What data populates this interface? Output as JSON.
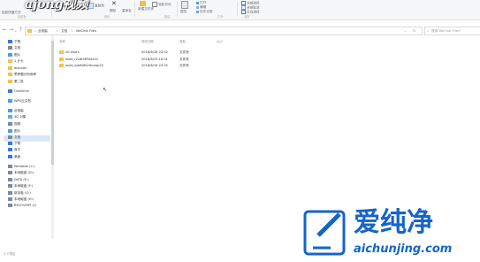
{
  "overlay_title": "ajong视频",
  "ribbon": {
    "groups": [
      {
        "label": "剪贴板"
      },
      {
        "label": "组织"
      },
      {
        "label": "新建"
      },
      {
        "label": "打开"
      },
      {
        "label": "选择"
      }
    ],
    "items": {
      "paste_shortcut": "粘贴快捷方式",
      "move_to": "移动到",
      "copy_to": "复制到",
      "delete": "删除",
      "rename": "重命名",
      "new_folder": "新建文件夹",
      "easy_access": "轻松访问",
      "properties": "属性",
      "open": "打开",
      "edit": "编辑",
      "history": "历史记录",
      "select_all": "全部选择",
      "select_none": "全部取消",
      "invert": "反向选择"
    }
  },
  "addressbar": {
    "breadcrumbs": [
      "此电脑",
      "文档",
      "WeChat Files"
    ],
    "search_placeholder": "搜索\"WeChat Files\""
  },
  "nav": [
    {
      "label": "下载",
      "icon": "download-icon",
      "color": "#3b78d8"
    },
    {
      "label": "文档",
      "icon": "document-icon",
      "color": "#7a8aa0"
    },
    {
      "label": "图片",
      "icon": "picture-icon",
      "color": "#4aa0d8"
    },
    {
      "label": "1 计头",
      "icon": "folder-icon",
      "color": "#f1c24b"
    },
    {
      "label": "dianvan",
      "icon": "folder-icon",
      "color": "#f1c24b"
    },
    {
      "label": "思考题分析和考",
      "icon": "folder-icon",
      "color": "#f1c24b"
    },
    {
      "label": "第二批",
      "icon": "folder-icon",
      "color": "#f1c24b"
    },
    {
      "label": "OneDrive",
      "icon": "cloud-icon",
      "color": "#3b78d8"
    },
    {
      "label": "WPS云文档",
      "icon": "cloud-icon",
      "color": "#4aa0d8"
    },
    {
      "label": "此电脑",
      "icon": "computer-icon",
      "color": "#4aa0d8"
    },
    {
      "label": "3D 对象",
      "icon": "cube-icon",
      "color": "#6aaae0"
    },
    {
      "label": "视频",
      "icon": "video-icon",
      "color": "#7a8aa0"
    },
    {
      "label": "图片",
      "icon": "picture-icon",
      "color": "#4aa0d8"
    },
    {
      "label": "文档",
      "icon": "document-icon",
      "color": "#7a8aa0",
      "selected": true
    },
    {
      "label": "下载",
      "icon": "download-icon",
      "color": "#3b78d8"
    },
    {
      "label": "音乐",
      "icon": "music-icon",
      "color": "#3b78d8"
    },
    {
      "label": "桌面",
      "icon": "desktop-icon",
      "color": "#3b78d8"
    },
    {
      "label": "Windows (C:)",
      "icon": "drive-icon",
      "color": "#7a8aa0"
    },
    {
      "label": "本地磁盘 (D:)",
      "icon": "drive-icon",
      "color": "#7a8aa0"
    },
    {
      "label": "DATA (E:)",
      "icon": "drive-icon",
      "color": "#7a8aa0"
    },
    {
      "label": "本地磁盘 (F:)",
      "icon": "drive-icon",
      "color": "#7a8aa0"
    },
    {
      "label": "新加卷 (G:)",
      "icon": "drive-icon",
      "color": "#7a8aa0"
    },
    {
      "label": "本地磁盘 (H:)",
      "icon": "drive-icon",
      "color": "#7a8aa0"
    },
    {
      "label": "RECOVERY (I:)",
      "icon": "drive-icon",
      "color": "#7a8aa0"
    }
  ],
  "columns": {
    "name": "名称",
    "date": "修改日期",
    "type": "类型",
    "size": "大小"
  },
  "files": [
    {
      "name": "All Users",
      "date": "2018/6/16 23:32",
      "type": "文件夹"
    },
    {
      "name": "wxid_r2c8t5ff5t4e22",
      "date": "2018/6/19 18:31",
      "type": "文件夹"
    },
    {
      "name": "wxid_svb8r8k2itcxwp22",
      "date": "2018/6/16 23:32",
      "type": "文件夹"
    }
  ],
  "status": {
    "count": "3 个项目"
  },
  "watermark": {
    "brand": "爱纯净",
    "url": "aichunjing.com",
    "brand_color": "#1565c8"
  }
}
